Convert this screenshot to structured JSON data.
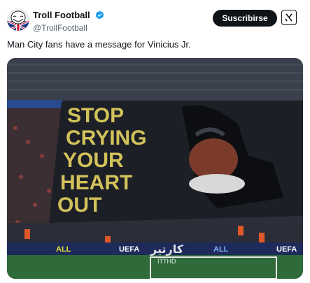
{
  "author": {
    "display_name": "Troll Football",
    "handle": "@TrollFootball",
    "verified": true
  },
  "actions": {
    "subscribe_label": "Suscribirse",
    "grok_icon": "grok-icon"
  },
  "tweet": {
    "text": "Man City fans have a message for Vinicius Jr."
  },
  "media": {
    "banner_lines": [
      "STOP",
      "CRYING",
      "YOUR",
      "HEART",
      "OUT"
    ],
    "ad_boards": [
      "ALL",
      "UEFA",
      "ALL",
      "UEFA"
    ],
    "watermark": "كارتير",
    "watermark_sub": "ITTHD"
  },
  "colors": {
    "banner_text": "#d2c25a",
    "banner_bg": "#1d1f26",
    "subscribe_bg": "#0f1419",
    "verified": "#1d9bf0"
  }
}
